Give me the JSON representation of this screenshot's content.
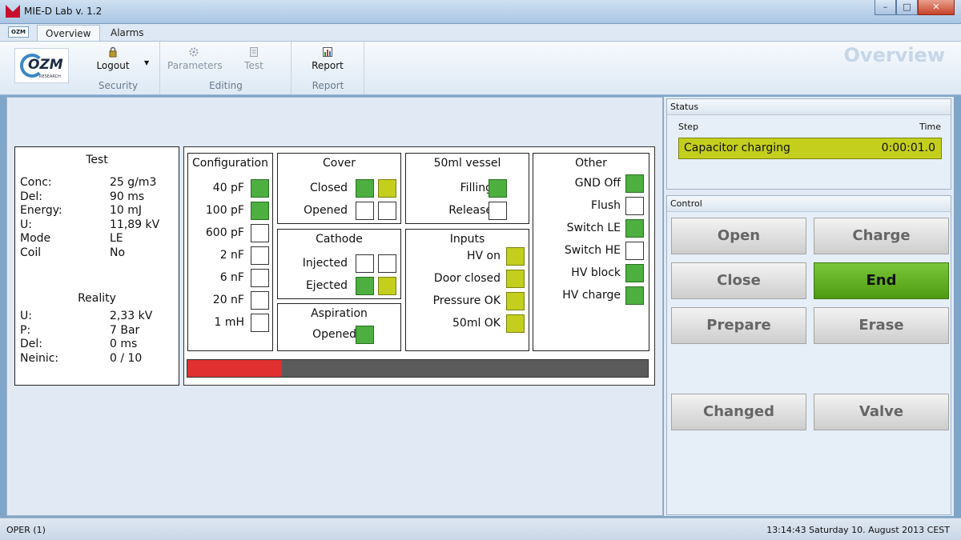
{
  "window": {
    "title": "MIE-D Lab v. 1.2",
    "min": "–",
    "max": "□",
    "close": "✕"
  },
  "ribbon": {
    "qat_label": "OZM",
    "tabs": [
      {
        "label": "Overview"
      },
      {
        "label": "Alarms"
      }
    ],
    "logo_text": "OZM",
    "logo_sub": "RESEARCH",
    "groups": {
      "security": {
        "label": "Security",
        "logout": "Logout"
      },
      "editing": {
        "label": "Editing",
        "parameters": "Parameters",
        "test": "Test"
      },
      "report": {
        "label": "Report",
        "report": "Report"
      }
    },
    "page_title": "Overview"
  },
  "test": {
    "title": "Test",
    "rows": [
      {
        "k": "Conc:",
        "v": "25  g/m3"
      },
      {
        "k": "Del:",
        "v": "90 ms"
      },
      {
        "k": "Energy:",
        "v": "10 mJ"
      },
      {
        "k": "U:",
        "v": "11,89  kV"
      },
      {
        "k": "Mode",
        "v": "LE"
      },
      {
        "k": "Coil",
        "v": "No"
      }
    ],
    "reality_title": "Reality",
    "reality_rows": [
      {
        "k": "U:",
        "v": "2,33  kV"
      },
      {
        "k": "P:",
        "v": "7 Bar"
      },
      {
        "k": "Del:",
        "v": "0 ms"
      },
      {
        "k": "Neinic:",
        "v": "0 / 10"
      }
    ]
  },
  "configuration": {
    "title": "Configuration",
    "items": [
      {
        "label": "40 pF",
        "state": "green"
      },
      {
        "label": "100 pF",
        "state": "green"
      },
      {
        "label": "600 pF",
        "state": "off"
      },
      {
        "label": "2 nF",
        "state": "off"
      },
      {
        "label": "6 nF",
        "state": "off"
      },
      {
        "label": "20 nF",
        "state": "off"
      },
      {
        "label": "1 mH",
        "state": "off"
      }
    ]
  },
  "cover": {
    "title": "Cover",
    "items": [
      {
        "label": "Closed",
        "a": "green",
        "b": "yellow"
      },
      {
        "label": "Opened",
        "a": "off",
        "b": "off"
      }
    ]
  },
  "cathode": {
    "title": "Cathode",
    "items": [
      {
        "label": "Injected",
        "a": "off",
        "b": "off"
      },
      {
        "label": "Ejected",
        "a": "green",
        "b": "yellow"
      }
    ]
  },
  "aspiration": {
    "title": "Aspiration",
    "items": [
      {
        "label": "Opened",
        "state": "green"
      }
    ]
  },
  "vessel": {
    "title": "50ml vessel",
    "items": [
      {
        "label": "Filling",
        "state": "green"
      },
      {
        "label": "Release",
        "state": "off"
      }
    ]
  },
  "inputs": {
    "title": "Inputs",
    "items": [
      {
        "label": "HV on",
        "state": "yellow"
      },
      {
        "label": "Door closed",
        "state": "yellow"
      },
      {
        "label": "Pressure OK",
        "state": "yellow"
      },
      {
        "label": "50ml OK",
        "state": "yellow"
      }
    ]
  },
  "other": {
    "title": "Other",
    "items": [
      {
        "label": "GND Off",
        "state": "green"
      },
      {
        "label": "Flush",
        "state": "off"
      },
      {
        "label": "Switch LE",
        "state": "green"
      },
      {
        "label": "Switch HE",
        "state": "off"
      },
      {
        "label": "HV block",
        "state": "green"
      },
      {
        "label": "HV charge",
        "state": "green"
      }
    ]
  },
  "progress": {
    "fraction": 0.205
  },
  "status": {
    "title": "Status",
    "col_step": "Step",
    "col_time": "Time",
    "step": "Capacitor charging",
    "time": "0:00:01.0"
  },
  "control": {
    "title": "Control",
    "buttons": {
      "open": "Open",
      "charge": "Charge",
      "close": "Close",
      "end": "End",
      "prepare": "Prepare",
      "erase": "Erase",
      "changed": "Changed",
      "valve": "Valve"
    }
  },
  "statusbar": {
    "left": "OPER (1)",
    "right": "13:14:43 Saturday 10. August 2013 CEST"
  },
  "colors": {
    "green": "#4caf3f",
    "yellow": "#c3cf1c",
    "end_button": "#5aa81c",
    "progress": "#e03030"
  }
}
